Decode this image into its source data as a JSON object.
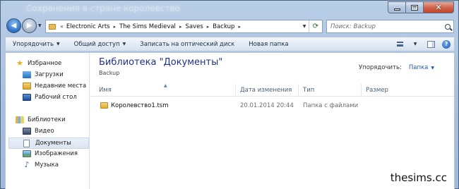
{
  "window": {
    "title_ghost": "Сохранения в стране королевство",
    "close_glyph": "✕"
  },
  "address_bar": {
    "chevrons": "«",
    "breadcrumbs": [
      "Electronic Arts",
      "The Sims Medieval",
      "Saves",
      "Backup"
    ],
    "separator": "▸",
    "refresh_icon": "refresh-icon"
  },
  "search": {
    "placeholder": "Поиск: Backup"
  },
  "toolbar": {
    "organize": "Упорядочить",
    "share": "Общий доступ",
    "burn": "Записать на оптический диск",
    "new_folder": "Новая папка",
    "help": "?"
  },
  "sidebar": {
    "favorites_label": "Избранное",
    "favorites": [
      "Загрузки",
      "Недавние места",
      "Рабочий стол"
    ],
    "libraries_label": "Библиотеки",
    "libraries": [
      "Видео",
      "Документы",
      "Изображения",
      "Музыка"
    ],
    "selected": "Документы"
  },
  "main": {
    "library_title": "Библиотека \"Документы\"",
    "library_subtitle": "Backup",
    "arrange_label": "Упорядочить:",
    "arrange_value": "Папка"
  },
  "columns": [
    "Имя",
    "Дата изменения",
    "Тип",
    "Размер"
  ],
  "files": [
    {
      "name": "Королевство1.tsm",
      "date": "20.01.2014 20:44",
      "type": "Папка с файлами",
      "size": ""
    }
  ],
  "watermark": "thesims.cc",
  "colors": {
    "accent": "#1e3287",
    "link": "#1e5bb0",
    "folder": "#deab35"
  }
}
